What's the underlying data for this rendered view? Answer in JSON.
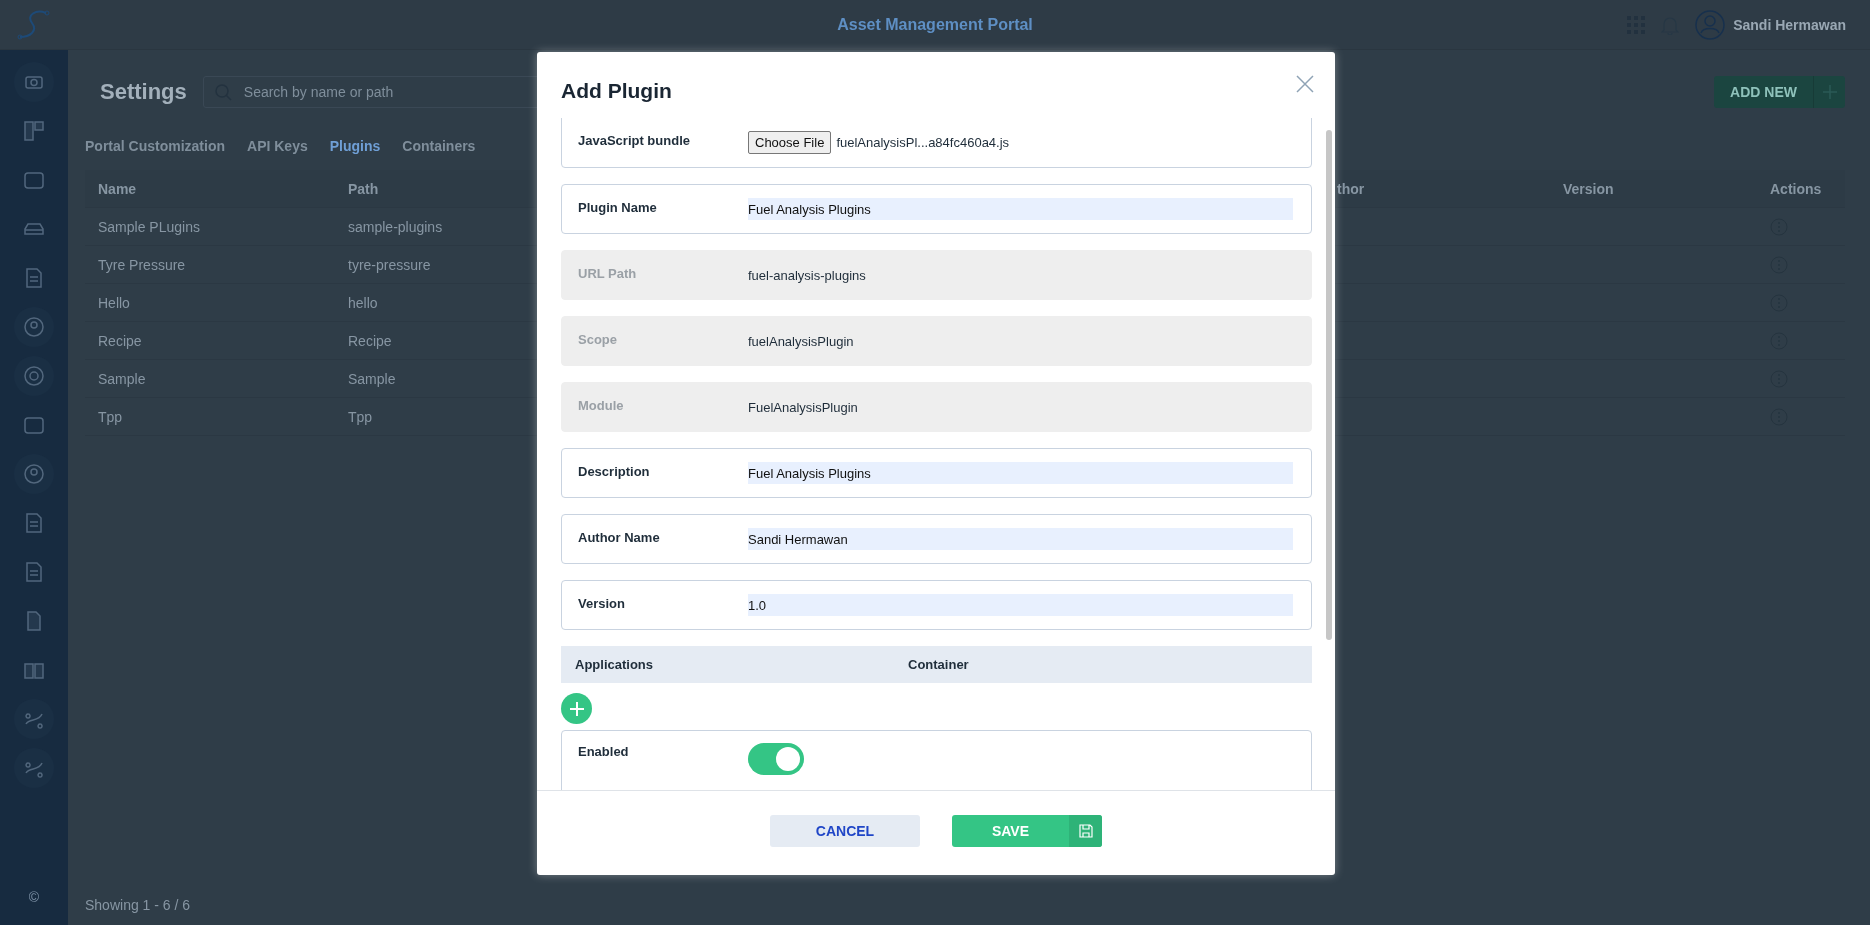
{
  "header": {
    "title": "Asset Management Portal",
    "user_name": "Sandi Hermawan"
  },
  "page": {
    "title": "Settings",
    "search": {
      "placeholder": "Search by name or path"
    },
    "add_button": "ADD NEW"
  },
  "tabs": [
    {
      "label": "Portal Customization",
      "selected": false
    },
    {
      "label": "API Keys",
      "selected": false
    },
    {
      "label": "Plugins",
      "selected": true
    },
    {
      "label": "Containers",
      "selected": false
    }
  ],
  "table": {
    "columns": [
      "Name",
      "Path",
      "thor",
      "Version",
      "Actions"
    ],
    "rows": [
      {
        "name": "Sample PLugins",
        "path": "sample-plugins"
      },
      {
        "name": "Tyre Pressure",
        "path": "tyre-pressure"
      },
      {
        "name": "Hello",
        "path": "hello"
      },
      {
        "name": "Recipe",
        "path": "Recipe"
      },
      {
        "name": "Sample",
        "path": "Sample"
      },
      {
        "name": "Tpp",
        "path": "Tpp"
      }
    ]
  },
  "footer": "Showing 1 - 6 / 6",
  "sidebar_footer": "©",
  "dialog": {
    "title": "Add Plugin",
    "fields": [
      {
        "kind": "file",
        "label": "JavaScript bundle",
        "button": "Choose File",
        "value": "fuelAnalysisPl...a84fc460a4.js"
      },
      {
        "kind": "input",
        "label": "Plugin Name",
        "value": "Fuel Analysis Plugins"
      },
      {
        "kind": "readonly",
        "label": "URL Path",
        "value": "fuel-analysis-plugins"
      },
      {
        "kind": "readonly",
        "label": "Scope",
        "value": "fuelAnalysisPlugin"
      },
      {
        "kind": "readonly",
        "label": "Module",
        "value": "FuelAnalysisPlugin"
      },
      {
        "kind": "input",
        "label": "Description",
        "value": "Fuel Analysis Plugins"
      },
      {
        "kind": "input",
        "label": "Author Name",
        "value": "Sandi Hermawan"
      },
      {
        "kind": "input",
        "label": "Version",
        "value": "1.0"
      }
    ],
    "applications": {
      "columns": [
        "Applications",
        "Container"
      ]
    },
    "enabled": {
      "label": "Enabled",
      "on": true
    },
    "buttons": {
      "cancel": "CANCEL",
      "save": "SAVE"
    }
  }
}
